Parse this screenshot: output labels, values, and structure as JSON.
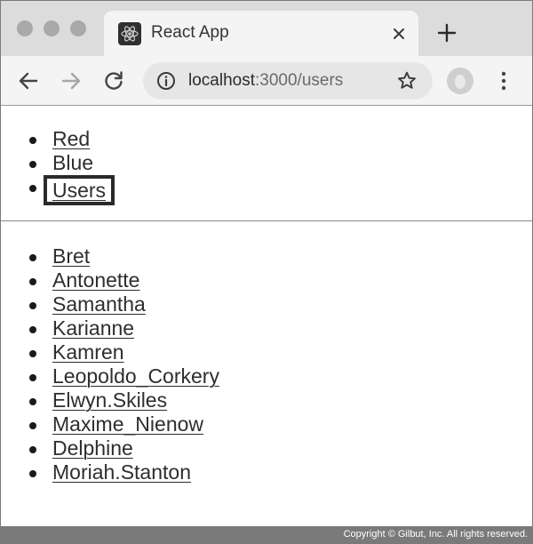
{
  "browser": {
    "tab": {
      "title": "React App",
      "favicon": "react-logo-icon"
    },
    "new_tab_label": "+",
    "address": {
      "host": "localhost",
      "path": ":3000/users"
    }
  },
  "nav_links": [
    {
      "label": "Red",
      "underlined": true
    },
    {
      "label": "Blue",
      "underlined": false
    },
    {
      "label": "Users",
      "underlined": true,
      "highlighted": true
    }
  ],
  "users": [
    "Bret",
    "Antonette",
    "Samantha",
    "Karianne",
    "Kamren",
    "Leopoldo_Corkery",
    "Elwyn.Skiles",
    "Maxime_Nienow",
    "Delphine",
    "Moriah.Stanton"
  ],
  "footer": {
    "copyright": "Copyright © Gilbut, Inc. All rights reserved."
  },
  "colors": {
    "tab_strip": "#dcdcdc",
    "toolbar": "#f4f4f4",
    "omnibox": "#e6e6e6",
    "link": "#2e2e2e",
    "footer": "#7a7a7a"
  }
}
